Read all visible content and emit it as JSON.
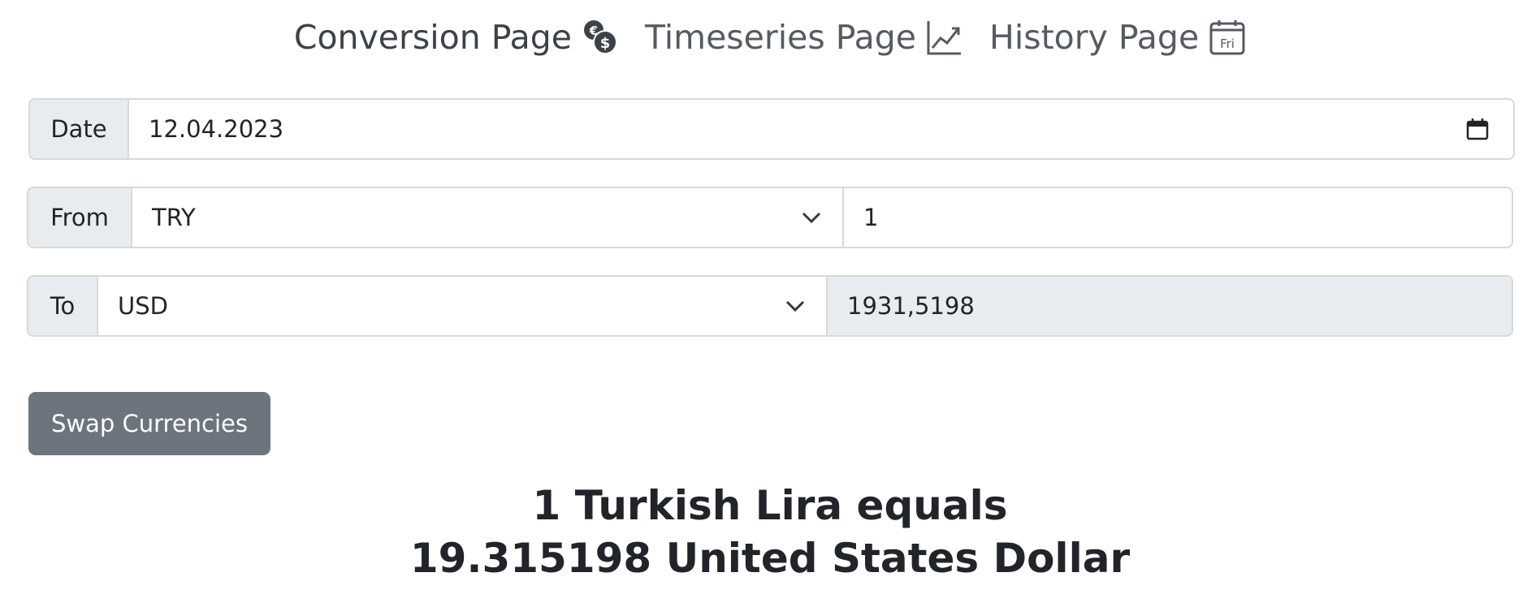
{
  "nav": {
    "conversion": {
      "label": "Conversion Page",
      "icon": "coins-euro-dollar-icon"
    },
    "timeseries": {
      "label": "Timeseries Page",
      "icon": "line-chart-icon"
    },
    "history": {
      "label": "History Page",
      "icon": "calendar-icon",
      "icon_text": "Fri"
    }
  },
  "date": {
    "label": "Date",
    "value": "12.04.2023"
  },
  "from": {
    "label": "From",
    "currency": "TRY",
    "amount": "1"
  },
  "to": {
    "label": "To",
    "currency": "USD",
    "amount": "1931,5198"
  },
  "swap_label": "Swap Currencies",
  "result": {
    "line1": "1 Turkish Lira equals",
    "line2": "19.315198 United States Dollar"
  },
  "colors": {
    "button_bg": "#6c757d",
    "addon_bg": "#e9ecef",
    "border": "#d6d9dd"
  }
}
